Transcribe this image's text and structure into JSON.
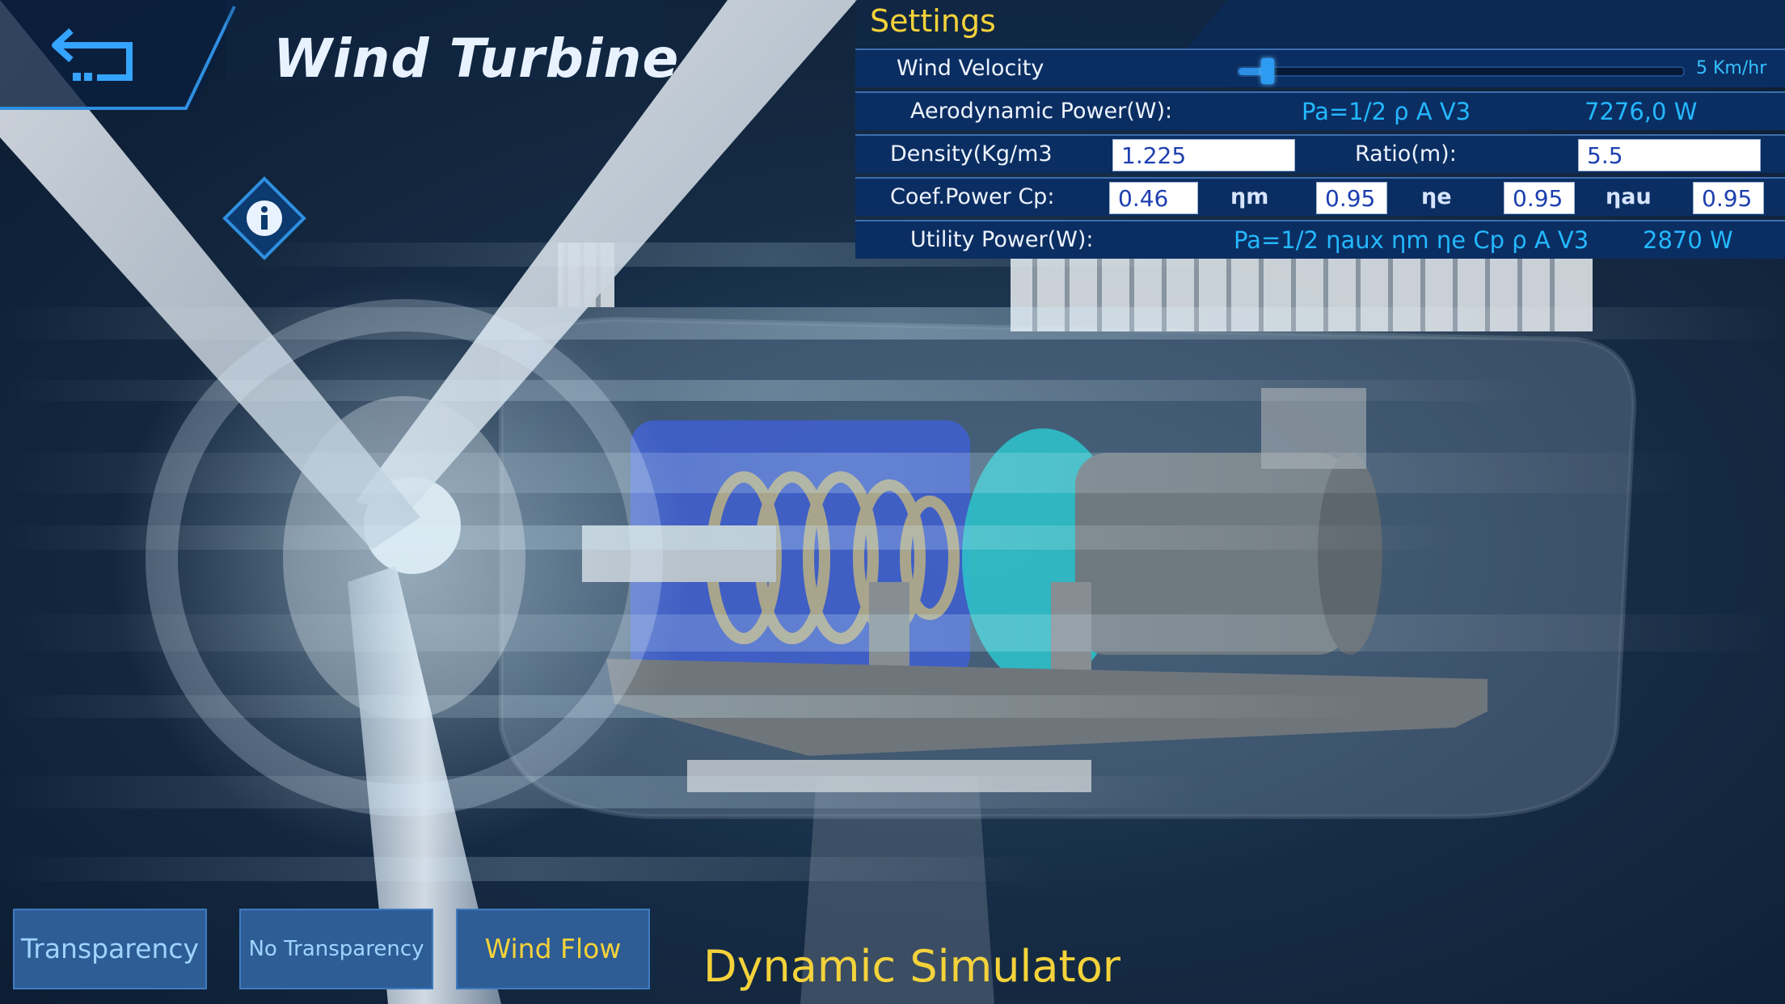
{
  "header": {
    "title": "Wind Turbine",
    "back_icon": "back-arrow-icon",
    "info_icon": "info-icon"
  },
  "settings": {
    "title": "Settings",
    "wind_velocity": {
      "label": "Wind Velocity",
      "value_text": "5 Km/hr",
      "slider_fraction": 0.05
    },
    "aerodynamic": {
      "label": "Aerodynamic Power(W):",
      "formula": "Pa=1/2 ρ A V3",
      "result": "7276,0 W"
    },
    "density": {
      "label": "Density(Kg/m3",
      "value": "1.225"
    },
    "ratio": {
      "label": "Ratio(m):",
      "value": "5.5"
    },
    "coefficients": {
      "cp_label": "Coef.Power Cp:",
      "cp_value": "0.46",
      "eta_m_label": "ηm",
      "eta_m_value": "0.95",
      "eta_e_label": "ηe",
      "eta_e_value": "0.95",
      "eta_au_label": "ηau",
      "eta_au_value": "0.95"
    },
    "utility": {
      "label": "Utility Power(W):",
      "formula": "Pa=1/2 ηaux ηm ηe Cp ρ A V3",
      "result": "2870 W"
    }
  },
  "buttons": {
    "transparency": "Transparency",
    "no_transparency": "No Transparency",
    "wind_flow": "Wind Flow"
  },
  "footer": {
    "title": "Dynamic Simulator"
  },
  "colors": {
    "accent_yellow": "#f4d23a",
    "panel_blue": "#0b2e62",
    "formula_cyan": "#24b8ff",
    "button_blue": "#2e5d95"
  }
}
